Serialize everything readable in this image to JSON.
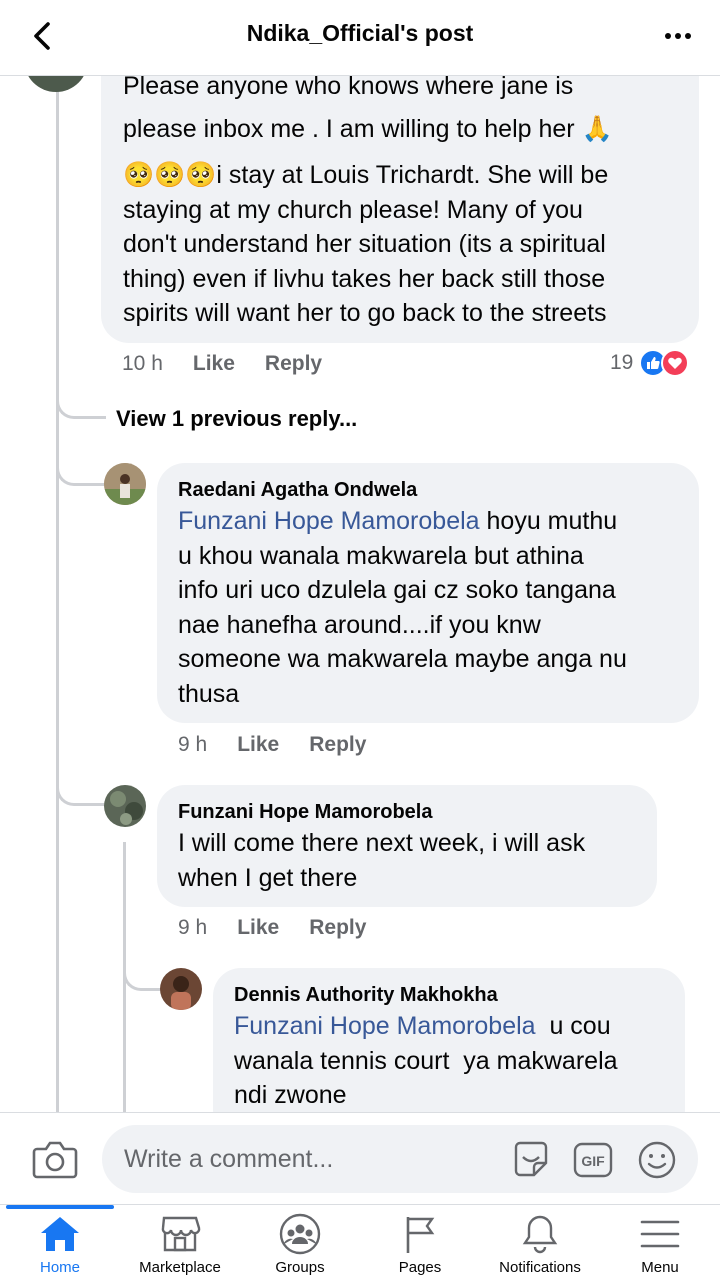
{
  "header": {
    "title": "Ndika_Official's post"
  },
  "comments": {
    "top": {
      "text_lines": [
        "Please anyone who knows where jane is",
        "please inbox me . I am willing to help her 🙏",
        "🥺🥺🥺i stay at Louis Trichardt. She will be",
        "staying at my church please! Many of you",
        "don't understand her situation (its a spiritual",
        "thing) even if livhu takes her back still those",
        "spirits will want her to go back to the streets"
      ],
      "time": "10 h",
      "like": "Like",
      "reply": "Reply",
      "reaction_count": "19"
    },
    "view_previous": "View 1 previous reply...",
    "reply1": {
      "author": "Raedani Agatha Ondwela",
      "mention": "Funzani Hope Mamorobela",
      "line1_rest": " hoyu muthu",
      "text_lines": [
        "u khou wanala makwarela but athina",
        "info uri uco dzulela gai cz soko tangana",
        "nae hanefha around....if you knw",
        "someone wa makwarela maybe anga nu",
        "thusa"
      ],
      "time": "9 h",
      "like": "Like",
      "reply": "Reply"
    },
    "reply2": {
      "author": "Funzani Hope Mamorobela",
      "text_lines": [
        "I will come there next week, i will ask",
        "when I get there"
      ],
      "time": "9 h",
      "like": "Like",
      "reply": "Reply"
    },
    "reply3": {
      "author": "Dennis Authority Makhokha",
      "mention": "Funzani Hope Mamorobela",
      "line1_rest": "  u cou",
      "text_lines": [
        "wanala tennis court  ya makwarela",
        "ndi zwone"
      ]
    }
  },
  "composer": {
    "placeholder": "Write a comment..."
  },
  "tabs": [
    {
      "label": "Home",
      "icon": "home-icon"
    },
    {
      "label": "Marketplace",
      "icon": "marketplace-icon"
    },
    {
      "label": "Groups",
      "icon": "groups-icon"
    },
    {
      "label": "Pages",
      "icon": "pages-icon"
    },
    {
      "label": "Notifications",
      "icon": "bell-icon"
    },
    {
      "label": "Menu",
      "icon": "menu-icon"
    }
  ],
  "colors": {
    "link": "#385898",
    "accent": "#1877f2",
    "bubble": "#f0f2f5",
    "muted": "#65676b"
  }
}
